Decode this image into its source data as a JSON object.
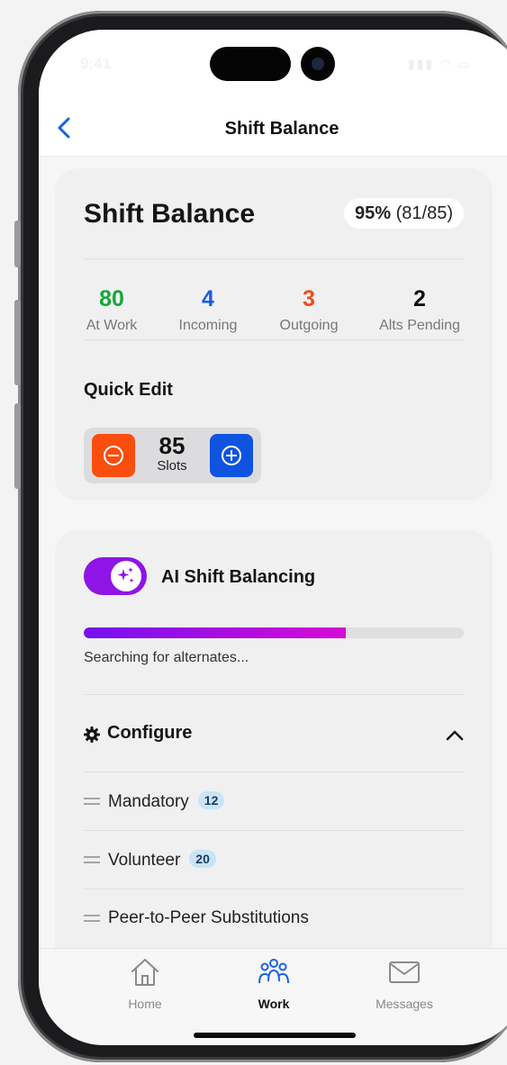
{
  "status_bar": {
    "time": "9:41"
  },
  "nav": {
    "title": "Shift Balance"
  },
  "balance_card": {
    "title": "Shift Balance",
    "percent": "95%",
    "ratio": "(81/85)",
    "stats": [
      {
        "value": "80",
        "label": "At Work",
        "color": "#14a83a"
      },
      {
        "value": "4",
        "label": "Incoming",
        "color": "#1a5ae0"
      },
      {
        "value": "3",
        "label": "Outgoing",
        "color": "#f24a16"
      },
      {
        "value": "2",
        "label": "Alts Pending",
        "color": "#111111"
      }
    ],
    "quick_edit_label": "Quick Edit",
    "slots_value": "85",
    "slots_label": "Slots"
  },
  "ai_card": {
    "title": "AI Shift Balancing",
    "toggle_on": true,
    "progress_percent": 69,
    "progress_text": "Searching for alternates...",
    "configure_label": "Configure",
    "items": [
      {
        "label": "Mandatory",
        "count": "12"
      },
      {
        "label": "Volunteer",
        "count": "20"
      },
      {
        "label": "Peer-to-Peer Substitutions"
      }
    ]
  },
  "tabs": [
    {
      "label": "Home",
      "icon": "home-icon",
      "active": false
    },
    {
      "label": "Work",
      "icon": "people-icon",
      "active": true
    },
    {
      "label": "Messages",
      "icon": "mail-icon",
      "active": false
    }
  ],
  "colors": {
    "accent_blue": "#0f54e0",
    "accent_orange": "#fa4e0f",
    "accent_purple": "#8f14e6"
  }
}
